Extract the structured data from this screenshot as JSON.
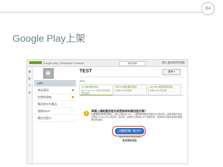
{
  "slide": {
    "page_number": "84",
    "title": "Google Play上架"
  },
  "console": {
    "brand": "Google play | Developer Console",
    "account": "(帳戶名稱)",
    "header_links": "登出  使用者意見回饋",
    "app_title": "TEST",
    "publish_button": "發佈 ▾",
    "apk_section": "APK",
    "nav_items": [
      {
        "label": "APK",
        "active": true
      },
      {
        "label": "商店資訊",
        "active": false
      },
      {
        "label": "定價與發佈",
        "active": false
      },
      {
        "label": "應用程式內產品",
        "active": false
      },
      {
        "label": "服務與API",
        "active": false
      },
      {
        "label": "最佳化提示",
        "active": false
      }
    ],
    "tabs": [
      {
        "label": "正式版環境設定",
        "sub": "在 Google Play 商店中發佈您的應用程式"
      },
      {
        "label": "BETA 測試環境設定",
        "sub": "管理 Beta 版測試"
      },
      {
        "label": "ALPHA 測試環境設定",
        "sub": "管理 Alpha 版測試"
      }
    ],
    "notice": {
      "title": "準備上傳新應用程式或更新現有應用程式嗎？",
      "body": "如要開始發佈應用程式，請先上傳您的 APK。只要將應用程式發佈到正式版環境，該應用程式就會出現在 Google Play 商店中。請注意，如果您上傳的是 APK 更新版本，該版本必須與先前版本簽署相同的憑證。"
    },
    "upload_button": "上傳您的第一個 APK",
    "or_text": "或是先設定商店資訊",
    "listing_link": "商店資訊設定"
  },
  "colors": {
    "accent_green": "#6a9a2a",
    "upload_blue": "#3a78c9",
    "highlight_red": "#e03a2f",
    "title_gray": "#6b7f8c"
  }
}
